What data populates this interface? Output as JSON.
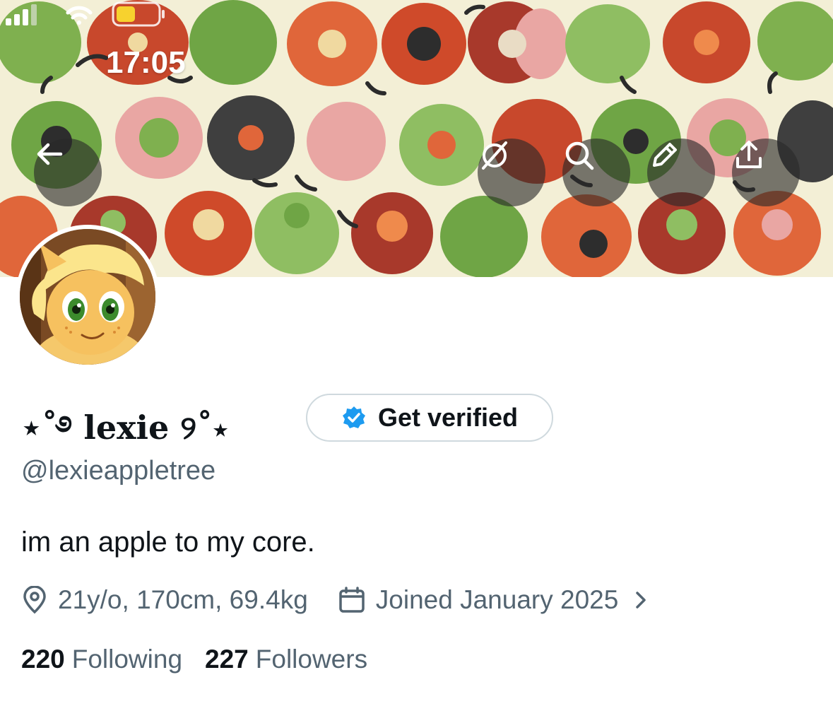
{
  "status_bar": {
    "time": "17:05"
  },
  "profile": {
    "display_name": "⋆˚࿔ lexie ୨˚⋆",
    "verify_button_label": "Get verified",
    "handle": "@lexieappletree",
    "bio": "im an apple to my core.",
    "location": "21y/o, 170cm, 69.4kg",
    "joined": "Joined January 2025",
    "following_count": "220",
    "following_label": "Following",
    "followers_count": "227",
    "followers_label": "Followers"
  },
  "header_buttons": [
    "back-icon",
    "grok-icon",
    "search-icon",
    "pencil-icon",
    "share-icon"
  ],
  "colors": {
    "verified_blue": "#1d9bf0",
    "secondary_text": "#536471",
    "primary_text": "#0f1419"
  }
}
